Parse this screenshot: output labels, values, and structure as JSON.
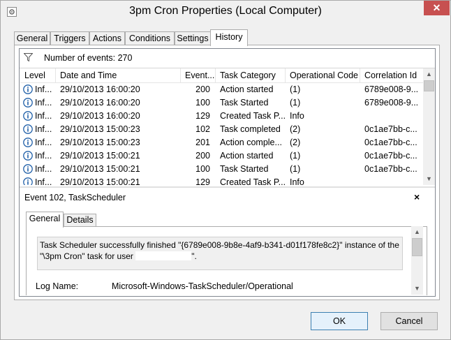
{
  "window": {
    "title": "3pm Cron Properties (Local Computer)",
    "close_glyph": "✕"
  },
  "tabs": [
    {
      "label": "General"
    },
    {
      "label": "Triggers"
    },
    {
      "label": "Actions"
    },
    {
      "label": "Conditions"
    },
    {
      "label": "Settings"
    },
    {
      "label": "History"
    }
  ],
  "history": {
    "events_label": "Number of events: 270",
    "columns": [
      "Level",
      "Date and Time",
      "Event...",
      "Task Category",
      "Operational Code",
      "Correlation Id"
    ],
    "rows": [
      {
        "level": "Inf...",
        "date": "29/10/2013 16:00:20",
        "event": "200",
        "category": "Action started",
        "opcode": "(1)",
        "corr": "6789e008-9..."
      },
      {
        "level": "Inf...",
        "date": "29/10/2013 16:00:20",
        "event": "100",
        "category": "Task Started",
        "opcode": "(1)",
        "corr": "6789e008-9..."
      },
      {
        "level": "Inf...",
        "date": "29/10/2013 16:00:20",
        "event": "129",
        "category": "Created Task P...",
        "opcode": "Info",
        "corr": ""
      },
      {
        "level": "Inf...",
        "date": "29/10/2013 15:00:23",
        "event": "102",
        "category": "Task completed",
        "opcode": "(2)",
        "corr": "0c1ae7bb-c..."
      },
      {
        "level": "Inf...",
        "date": "29/10/2013 15:00:23",
        "event": "201",
        "category": "Action comple...",
        "opcode": "(2)",
        "corr": "0c1ae7bb-c..."
      },
      {
        "level": "Inf...",
        "date": "29/10/2013 15:00:21",
        "event": "200",
        "category": "Action started",
        "opcode": "(1)",
        "corr": "0c1ae7bb-c..."
      },
      {
        "level": "Inf...",
        "date": "29/10/2013 15:00:21",
        "event": "100",
        "category": "Task Started",
        "opcode": "(1)",
        "corr": "0c1ae7bb-c..."
      },
      {
        "level": "Inf...",
        "date": "29/10/2013 15:00:21",
        "event": "129",
        "category": "Created Task P...",
        "opcode": "Info",
        "corr": ""
      }
    ]
  },
  "event_detail": {
    "title": "Event 102, TaskScheduler",
    "close_glyph": "×",
    "tabs": [
      {
        "label": "General"
      },
      {
        "label": "Details"
      }
    ],
    "message_part1": "Task Scheduler successfully finished \"{6789e008-9b8e-4af9-b341-d01f178fe8c2}\" instance of the \"\\3pm Cron\" task for user",
    "message_part2": "\".",
    "log_name_label": "Log Name:",
    "log_name_value": "Microsoft-Windows-TaskScheduler/Operational"
  },
  "buttons": {
    "ok": "OK",
    "cancel": "Cancel"
  },
  "icons": {
    "app": "properties-icon",
    "filter": "funnel-icon",
    "info": "info-circle-icon"
  },
  "colors": {
    "close_red": "#c75050",
    "info_blue": "#1f5fa8",
    "border": "#acacac"
  }
}
